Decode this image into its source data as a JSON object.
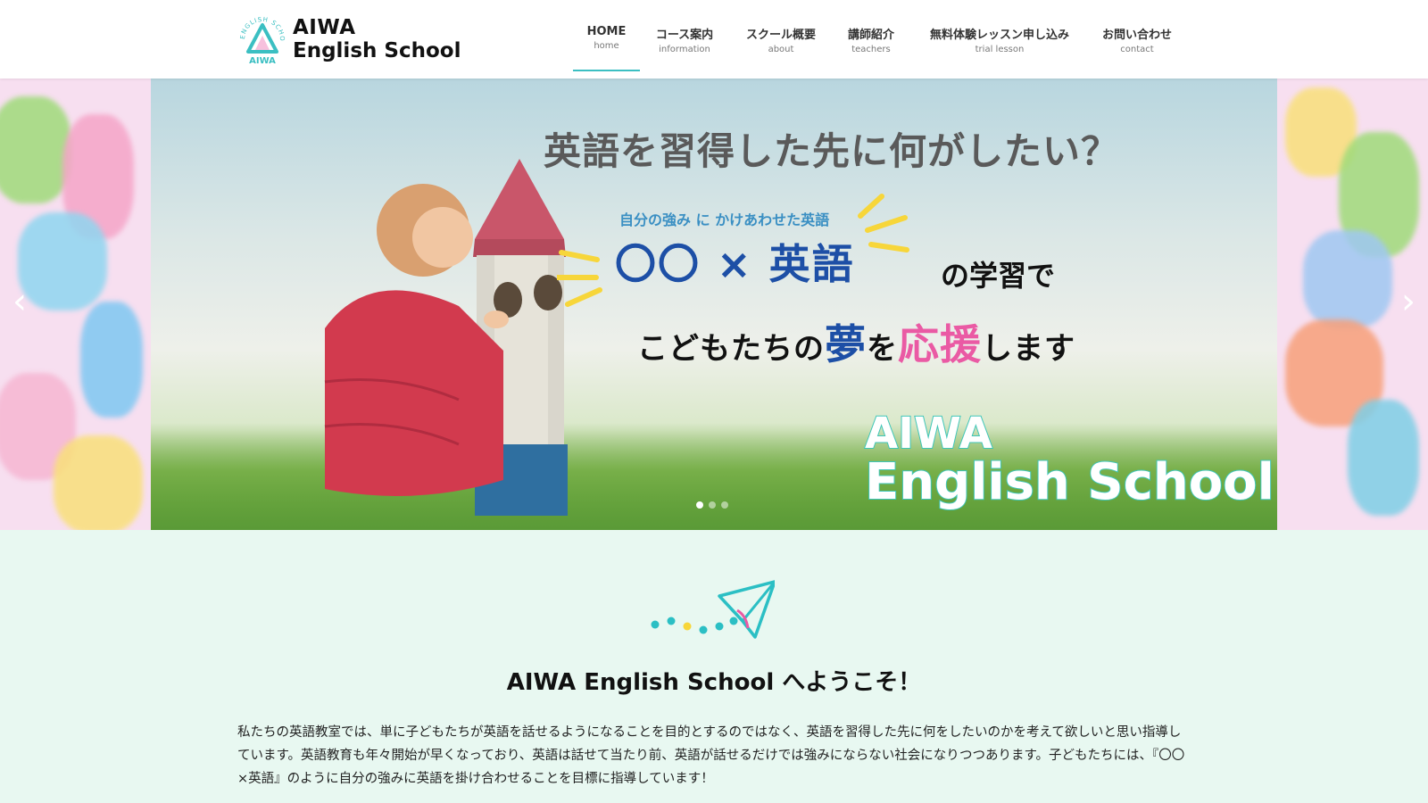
{
  "header": {
    "logo_title": "AIWA",
    "logo_subtitle": "English School",
    "logo_ring_text": "ENGLISH SCHOOL",
    "logo_mark_text": "AIWA",
    "nav": [
      {
        "label": "HOME",
        "sub": "home",
        "active": true
      },
      {
        "label": "コース案内",
        "sub": "information",
        "active": false
      },
      {
        "label": "スクール概要",
        "sub": "about",
        "active": false
      },
      {
        "label": "講師紹介",
        "sub": "teachers",
        "active": false
      },
      {
        "label": "無料体験レッスン申し込み",
        "sub": "trial lesson",
        "active": false
      },
      {
        "label": "お問い合わせ",
        "sub": "contact",
        "active": false
      }
    ]
  },
  "hero": {
    "headline": "英語を習得した先に何がしたい？",
    "subline": "自分の強み に かけあわせた英語",
    "big_line": "〇〇 × 英語",
    "learn_line": "の学習で",
    "support_prefix": "こどもたちの",
    "support_dream": "夢",
    "support_mid": "を",
    "support_cheer": "応援",
    "support_suffix": "します",
    "brand_1": "AIWA",
    "brand_2": "English School",
    "slide_count": 3,
    "active_slide": 1,
    "arrow_left_icon": "chevron-left-icon",
    "arrow_right_icon": "chevron-right-icon"
  },
  "welcome": {
    "title": "AIWA English School へようこそ！",
    "body": "私たちの英語教室では、単に子どもたちが英語を話せるようになることを目的とするのではなく、英語を習得した先に何をしたいのかを考えて欲しいと思い指導しています。英語教育も年々開始が早くなっており、英語は話せて当たり前、英語が話せるだけでは強みにならない社会になりつつあります。子どもたちには、『〇〇×英語』のように自分の強みに英語を掛け合わせることを目標に指導しています！"
  },
  "colors": {
    "accent": "#3bbfc2",
    "section_bg": "#e8f8f1",
    "dream_blue": "#1d4fa6",
    "cheer_pink": "#ea5aa4"
  }
}
